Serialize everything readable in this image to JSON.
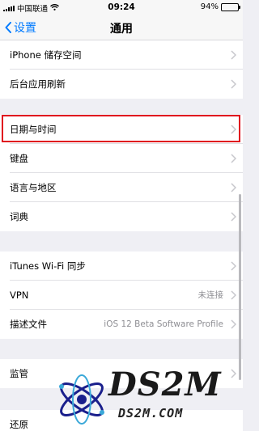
{
  "status_bar": {
    "carrier": "中国联通",
    "time": "09:24",
    "battery": "94%",
    "battery_level": 0.94
  },
  "nav": {
    "back_label": "设置",
    "title": "通用"
  },
  "rows": [
    {
      "label": "iPhone 储存空间",
      "value": ""
    },
    {
      "label": "后台应用刷新",
      "value": ""
    },
    {
      "label": "日期与时间",
      "value": ""
    },
    {
      "label": "键盘",
      "value": ""
    },
    {
      "label": "语言与地区",
      "value": ""
    },
    {
      "label": "词典",
      "value": ""
    },
    {
      "label": "iTunes Wi-Fi 同步",
      "value": ""
    },
    {
      "label": "VPN",
      "value": "未连接"
    },
    {
      "label": "描述文件",
      "value": "iOS 12 Beta Software Profile"
    },
    {
      "label": "监管",
      "value": ""
    },
    {
      "label": "还原",
      "value": ""
    }
  ],
  "watermark": {
    "text": "DS2M",
    "subtext": "DS2M.COM"
  },
  "colors": {
    "accent": "#007aff",
    "highlight": "#e0101e",
    "background": "#efeff4"
  }
}
